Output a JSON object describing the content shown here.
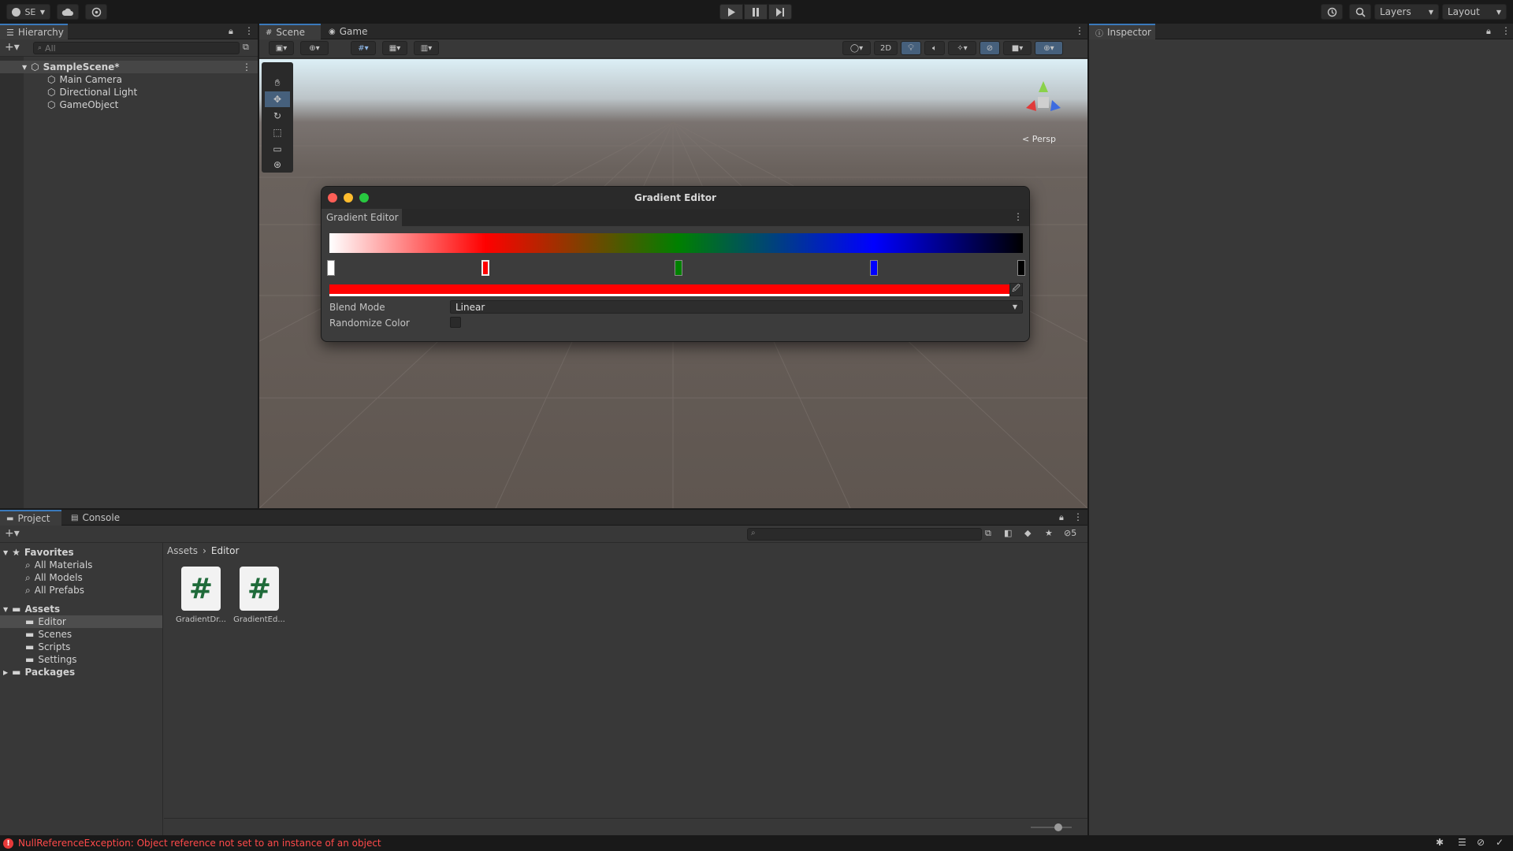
{
  "toolbar": {
    "account_label": "SE",
    "layers_label": "Layers",
    "layout_label": "Layout"
  },
  "hierarchy": {
    "tab_label": "Hierarchy",
    "search_placeholder": "All",
    "scene_name": "SampleScene*",
    "items": [
      {
        "label": "Main Camera"
      },
      {
        "label": "Directional Light"
      },
      {
        "label": "GameObject"
      }
    ]
  },
  "scene_view": {
    "tabs": [
      {
        "label": "Scene"
      },
      {
        "label": "Game"
      }
    ],
    "mode_2d_label": "2D",
    "projection_label": "Persp"
  },
  "inspector": {
    "tab_label": "Inspector"
  },
  "gradient_editor": {
    "window_title": "Gradient Editor",
    "tab_label": "Gradient Editor",
    "gradient_stops": [
      {
        "color": "#ffffff",
        "position": 0.0
      },
      {
        "color": "#ff0000",
        "position": 0.225
      },
      {
        "color": "#008000",
        "position": 0.503
      },
      {
        "color": "#0000ff",
        "position": 0.785
      },
      {
        "color": "#000000",
        "position": 1.0
      }
    ],
    "selected_key_color": "#ff0000",
    "blend_mode_label": "Blend Mode",
    "blend_mode_value": "Linear",
    "randomize_label": "Randomize Color",
    "randomize_checked": false
  },
  "project": {
    "tabs": [
      {
        "label": "Project"
      },
      {
        "label": "Console"
      }
    ],
    "favorites_label": "Favorites",
    "favorites": [
      {
        "label": "All Materials"
      },
      {
        "label": "All Models"
      },
      {
        "label": "All Prefabs"
      }
    ],
    "assets_label": "Assets",
    "asset_folders": [
      {
        "label": "Editor"
      },
      {
        "label": "Scenes"
      },
      {
        "label": "Scripts"
      },
      {
        "label": "Settings"
      }
    ],
    "packages_label": "Packages",
    "breadcrumb": [
      "Assets",
      "Editor"
    ],
    "files": [
      {
        "label": "GradientDr..."
      },
      {
        "label": "GradientEd..."
      }
    ],
    "hidden_count": "5"
  },
  "status": {
    "error_message": "NullReferenceException: Object reference not set to an instance of an object"
  },
  "colors": {
    "accent": "#3a79bb",
    "error": "#ff4a4a",
    "script_icon": "#1f6b3a"
  }
}
